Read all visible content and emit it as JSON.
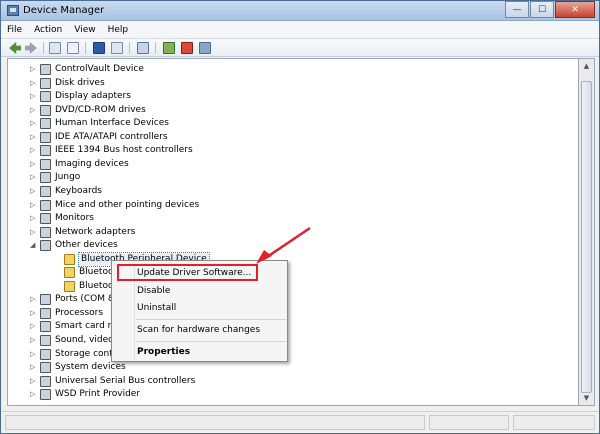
{
  "window": {
    "title": "Device Manager"
  },
  "title_buttons": {
    "minimize": "—",
    "maximize": "☐",
    "close": "✕"
  },
  "menu": [
    "File",
    "Action",
    "View",
    "Help"
  ],
  "toolbar_icons": [
    "back-icon",
    "forward-icon",
    "properties-icon",
    "list-icon",
    "help-icon",
    "tree-icon",
    "scan-icon",
    "update-driver-icon",
    "uninstall-icon",
    "disable-icon"
  ],
  "tree": [
    {
      "label": "ControlVault Device",
      "expander": "▷",
      "level": 0
    },
    {
      "label": "Disk drives",
      "expander": "▷",
      "level": 0
    },
    {
      "label": "Display adapters",
      "expander": "▷",
      "level": 0
    },
    {
      "label": "DVD/CD-ROM drives",
      "expander": "▷",
      "level": 0
    },
    {
      "label": "Human Interface Devices",
      "expander": "▷",
      "level": 0
    },
    {
      "label": "IDE ATA/ATAPI controllers",
      "expander": "▷",
      "level": 0
    },
    {
      "label": "IEEE 1394 Bus host controllers",
      "expander": "▷",
      "level": 0
    },
    {
      "label": "Imaging devices",
      "expander": "▷",
      "level": 0
    },
    {
      "label": "Jungo",
      "expander": "▷",
      "level": 0
    },
    {
      "label": "Keyboards",
      "expander": "▷",
      "level": 0
    },
    {
      "label": "Mice and other pointing devices",
      "expander": "▷",
      "level": 0
    },
    {
      "label": "Monitors",
      "expander": "▷",
      "level": 0
    },
    {
      "label": "Network adapters",
      "expander": "▷",
      "level": 0
    },
    {
      "label": "Other devices",
      "expander": "◢",
      "level": 0
    },
    {
      "label": "Bluetooth Peripheral Device",
      "expander": "",
      "level": 1,
      "warning": true,
      "selected": true
    },
    {
      "label": "Bluetooth P",
      "expander": "",
      "level": 1,
      "warning": true
    },
    {
      "label": "Bluetooth P",
      "expander": "",
      "level": 1,
      "warning": true
    },
    {
      "label": "Ports (COM &",
      "expander": "▷",
      "level": 0
    },
    {
      "label": "Processors",
      "expander": "▷",
      "level": 0
    },
    {
      "label": "Smart card rea",
      "expander": "▷",
      "level": 0
    },
    {
      "label": "Sound, video a",
      "expander": "▷",
      "level": 0
    },
    {
      "label": "Storage contro",
      "expander": "▷",
      "level": 0
    },
    {
      "label": "System devices",
      "expander": "▷",
      "level": 0
    },
    {
      "label": "Universal Serial Bus controllers",
      "expander": "▷",
      "level": 0
    },
    {
      "label": "WSD Print Provider",
      "expander": "▷",
      "level": 0
    }
  ],
  "context_menu": {
    "update": "Update Driver Software...",
    "disable": "Disable",
    "uninstall": "Uninstall",
    "scan": "Scan for hardware changes",
    "properties": "Properties"
  },
  "colors": {
    "annotation": "#e0202a",
    "warning": "#f1d36a"
  }
}
